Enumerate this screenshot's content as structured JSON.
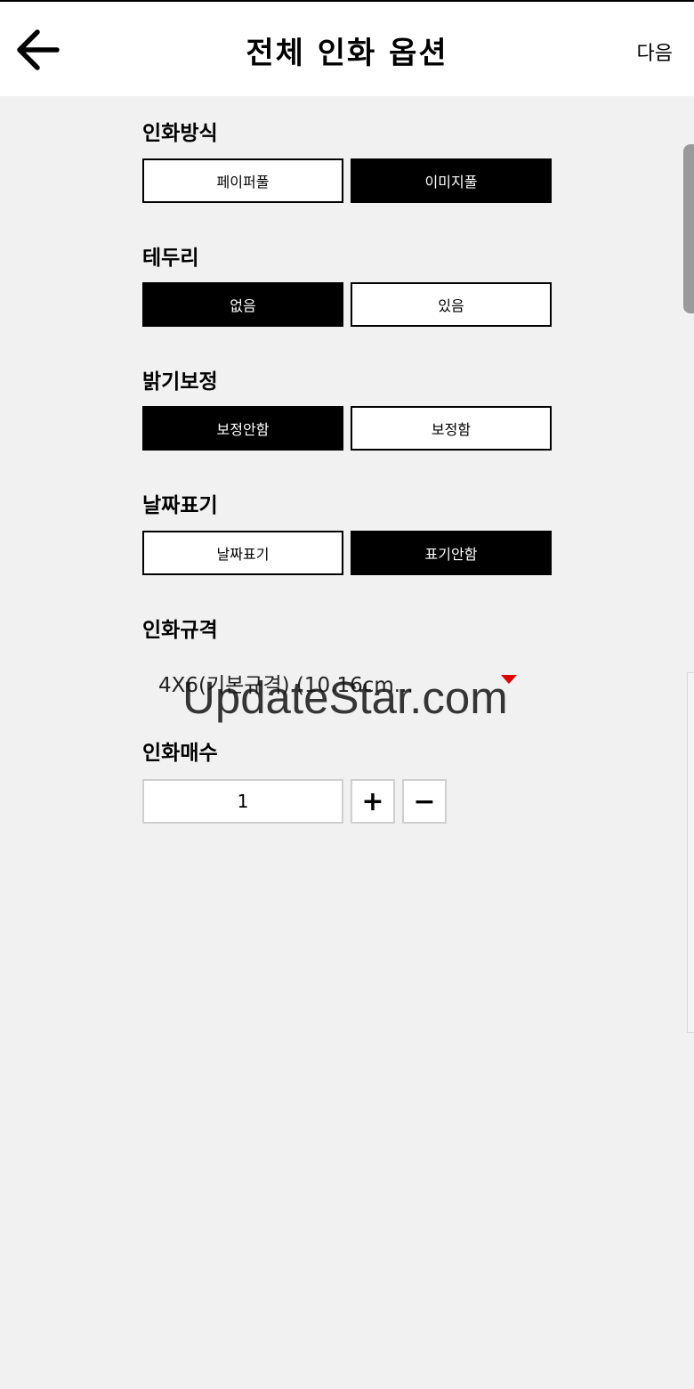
{
  "header": {
    "back_icon": "arrow-left-icon",
    "title": "전체 인화 옵션",
    "next_label": "다음"
  },
  "sections": {
    "print_method": {
      "label": "인화방식",
      "options": [
        "페이퍼풀",
        "이미지풀"
      ],
      "selected": "이미지풀"
    },
    "border": {
      "label": "테두리",
      "options": [
        "없음",
        "있음"
      ],
      "selected": "없음"
    },
    "brightness": {
      "label": "밝기보정",
      "options": [
        "보정안함",
        "보정함"
      ],
      "selected": "보정안함"
    },
    "date_stamp": {
      "label": "날짜표기",
      "options": [
        "날짜표기",
        "표기안함"
      ],
      "selected": "표기안함"
    },
    "print_size": {
      "label": "인화규격",
      "value": "4X6(기본규격) (10.16cm...",
      "dropdown_icon": "triangle-down-icon"
    },
    "quantity": {
      "label": "인화매수",
      "value": "1",
      "plus_label": "+",
      "minus_label": "−"
    }
  },
  "watermark": "UpdateStar.com",
  "colors": {
    "selected_bg": "#000000",
    "page_bg": "#f1f1f1",
    "accent_red": "#e00000"
  }
}
